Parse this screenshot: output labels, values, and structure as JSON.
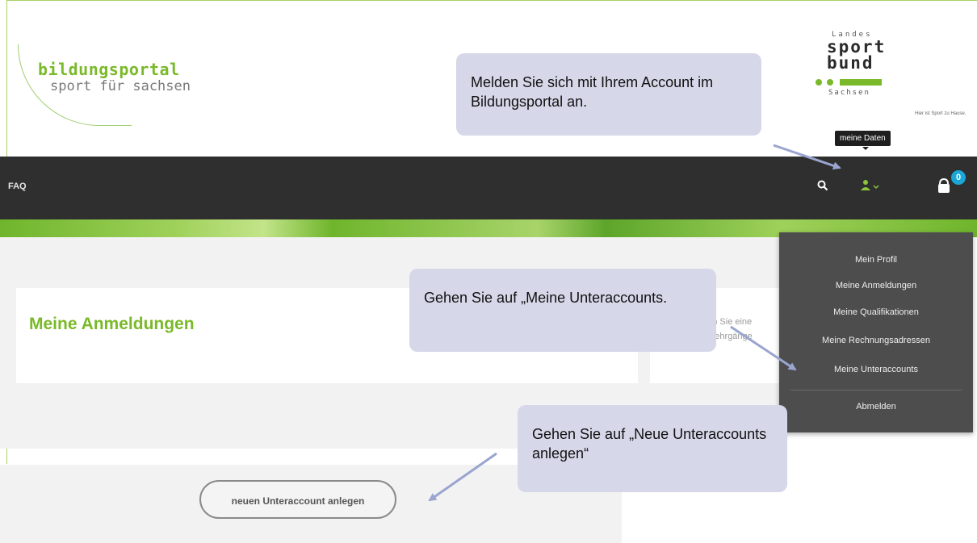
{
  "header": {
    "logo_title": "bildungsportal",
    "logo_subtitle": "sport für sachsen",
    "partner_logo": {
      "landes": "Landes",
      "sport": "sport",
      "bund": "bund",
      "sachsen": "Sachsen",
      "slogan": "Hier ist Sport zu Hause."
    },
    "tooltip": "meine Daten"
  },
  "navbar": {
    "faq_label": "FAQ",
    "icons": [
      "search-icon",
      "user-icon",
      "cart-icon"
    ],
    "cart_count": "0"
  },
  "dropdown": {
    "items": [
      "Mein Profil",
      "Meine Anmeldungen",
      "Meine Qualifikationen",
      "Meine Rechnungsadressen",
      "Meine Unteraccounts"
    ],
    "logout": "Abmelden"
  },
  "content": {
    "title": "Meine Anmeldungen",
    "side_text_line1": "den Sie eine",
    "side_text_line2": "n Lehrgänge",
    "new_subaccount_button": "neuen Unteraccount anlegen"
  },
  "callouts": {
    "login": "Melden Sie sich mit Ihrem Account im Bildungsportal an.",
    "subaccounts": "Gehen Sie auf „Meine Unteraccounts.",
    "new_subaccount": "Gehen Sie auf „Neue Unteraccounts anlegen“"
  },
  "colors": {
    "brand_green": "#7ab929",
    "navbar": "#2f2f2f",
    "dropdown": "#4d4d4d",
    "callout": "#d6d7e8",
    "arrow": "#9aa5d0",
    "badge": "#1aa7d7"
  }
}
